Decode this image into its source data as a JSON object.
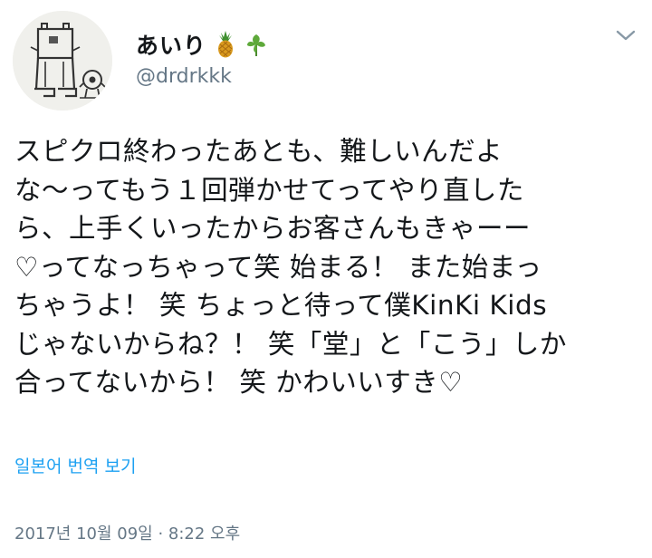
{
  "user": {
    "display_name": "あいり",
    "handle": "@drdrkkk",
    "name_emojis": [
      "pineapple-icon",
      "herb-icon"
    ]
  },
  "menu": {
    "icon": "chevron-down-icon"
  },
  "tweet": {
    "lines": [
      "スピクロ終わったあとも、難しいんだよ",
      "な〜ってもう１回弾かせてってやり直した",
      "ら、上手くいったからお客さんもきゃーー",
      "♡ってなっちゃって笑 始まる！ また始まっ",
      "ちゃうよ！ 笑 ちょっと待って僕KinKi Kids",
      "じゃないからね？！ 笑「堂」と「こう」しか",
      "合ってないから！ 笑 かわいいすき♡"
    ]
  },
  "translate": {
    "label": "일본어 번역 보기"
  },
  "meta": {
    "timestamp": "2017년 10월 09일 · 8:22 오후"
  },
  "colors": {
    "text": "#14171a",
    "secondary": "#657786",
    "link": "#1da1f2"
  }
}
